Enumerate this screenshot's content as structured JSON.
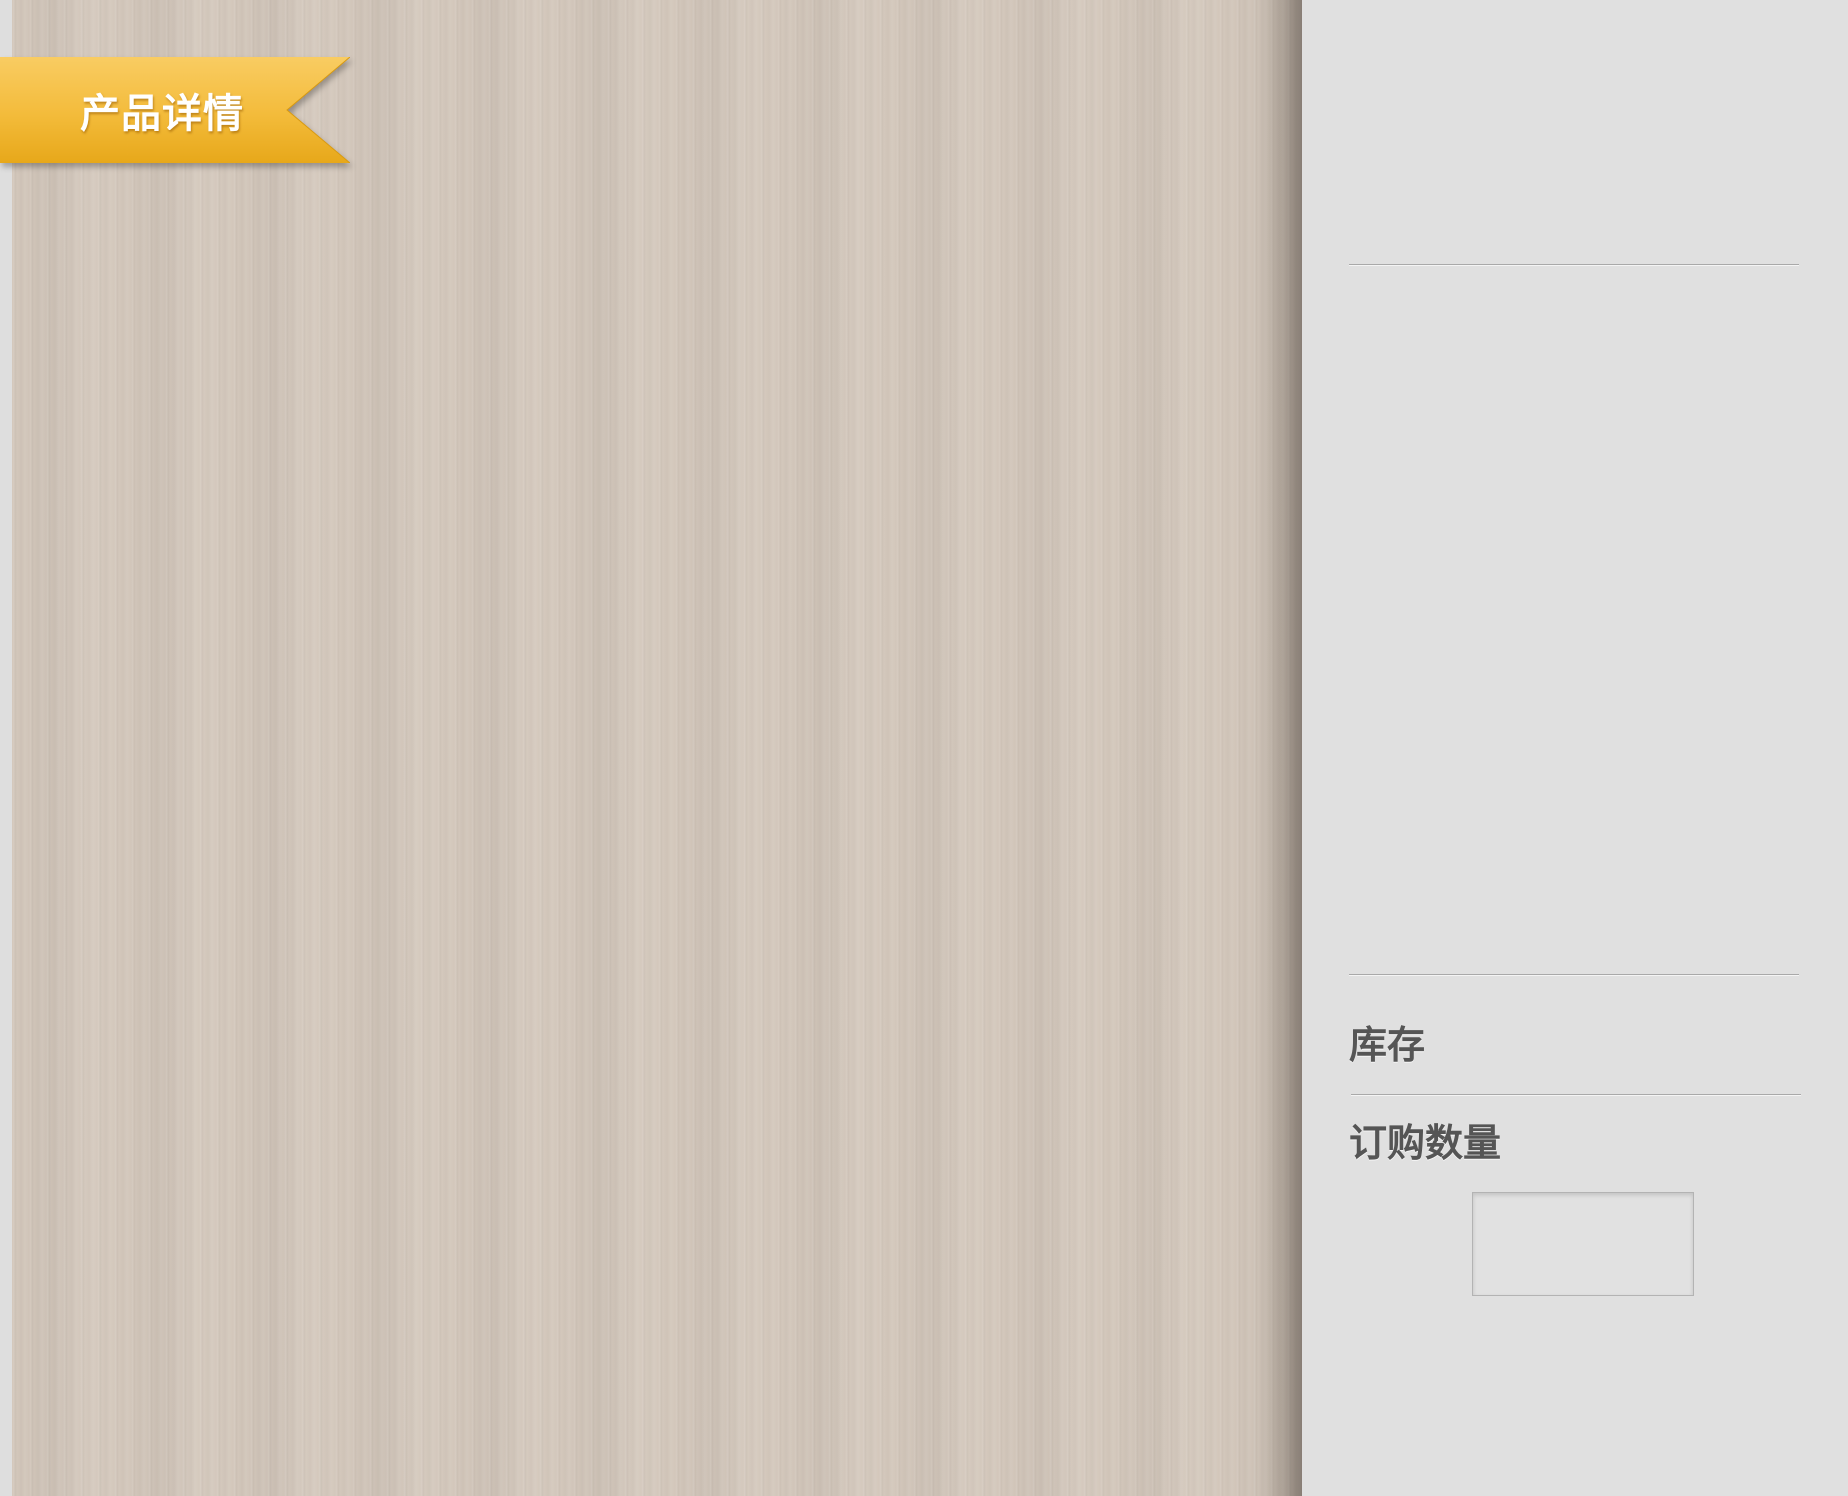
{
  "ribbon": {
    "label": "产品详情"
  },
  "info": {
    "stock_label": "库存",
    "order_quantity_label": "订购数量",
    "order_quantity_value": ""
  },
  "colors": {
    "ribbon_gold": "#f2b526",
    "ribbon_gold_light": "#f9cc62",
    "wood": "#d3c7bb",
    "panel_bg": "#e0e0e0",
    "label_text": "#555555"
  }
}
